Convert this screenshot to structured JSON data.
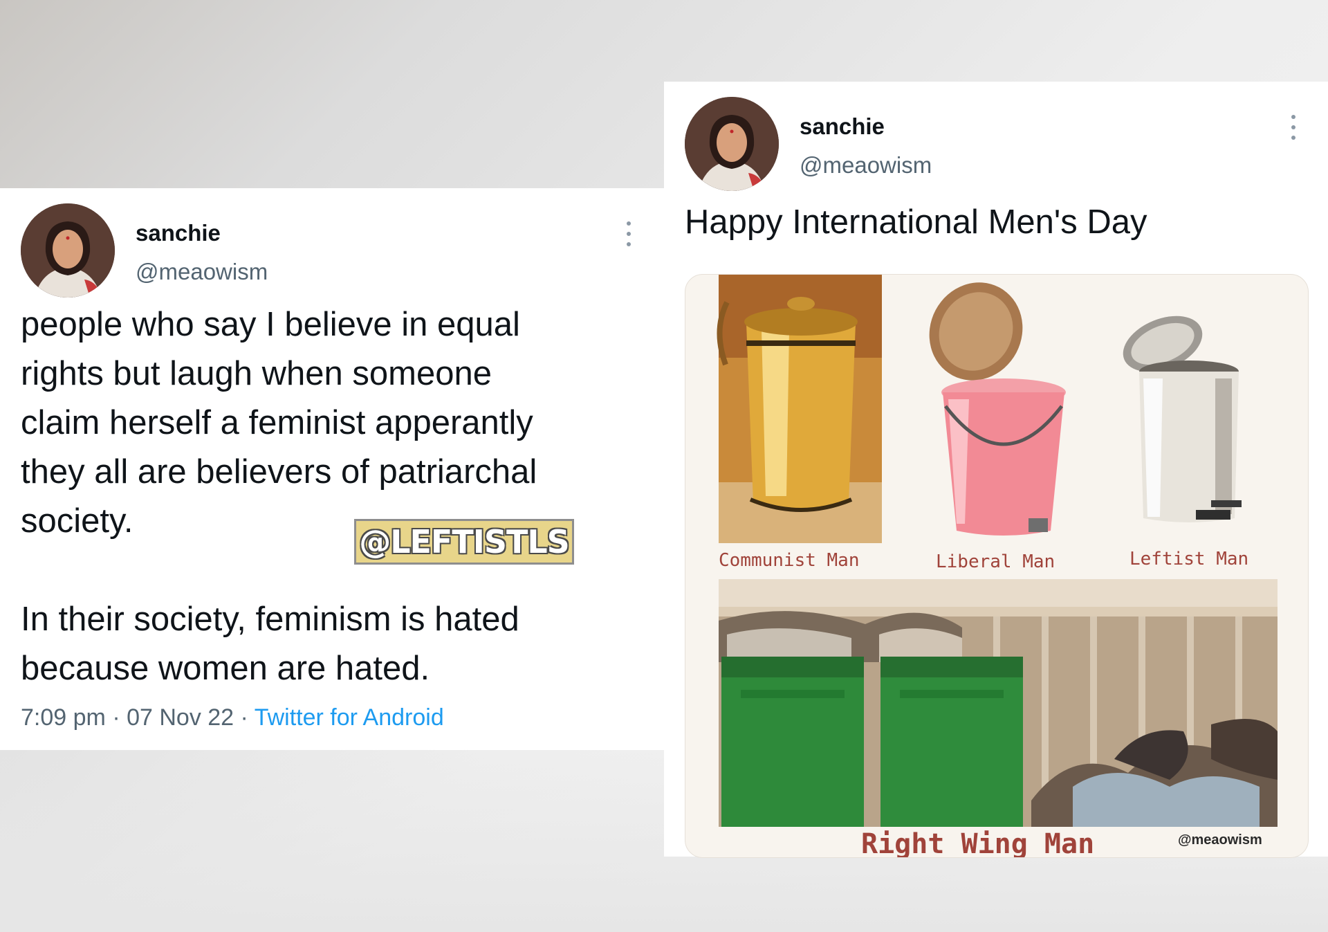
{
  "left_tweet": {
    "display_name": "sanchie",
    "handle": "@meaowism",
    "text": "people who say I believe in equal\nrights but laugh when someone\nclaim herself a feminist apperantly\nthey all are believers of patriarchal\nsociety.\n\nIn their society, feminism is hated\nbecause women are hated.",
    "watermark": "@LEFTISTLS",
    "time": "7:09 pm",
    "date": "07 Nov 22",
    "separator": "·",
    "source": "Twitter for Android"
  },
  "right_tweet": {
    "display_name": "sanchie",
    "handle": "@meaowism",
    "text": "Happy International Men's Day",
    "meme": {
      "labels": [
        "Communist Man",
        "Liberal Man",
        "Leftist Man"
      ],
      "bottom_label": "Right Wing Man",
      "credit": "@meaowism"
    }
  },
  "colors": {
    "text_primary": "#0f1419",
    "text_secondary": "#536471",
    "link": "#1d9bf0",
    "meme_label": "#a0433a"
  },
  "icons": [
    "more-vertical-icon"
  ]
}
